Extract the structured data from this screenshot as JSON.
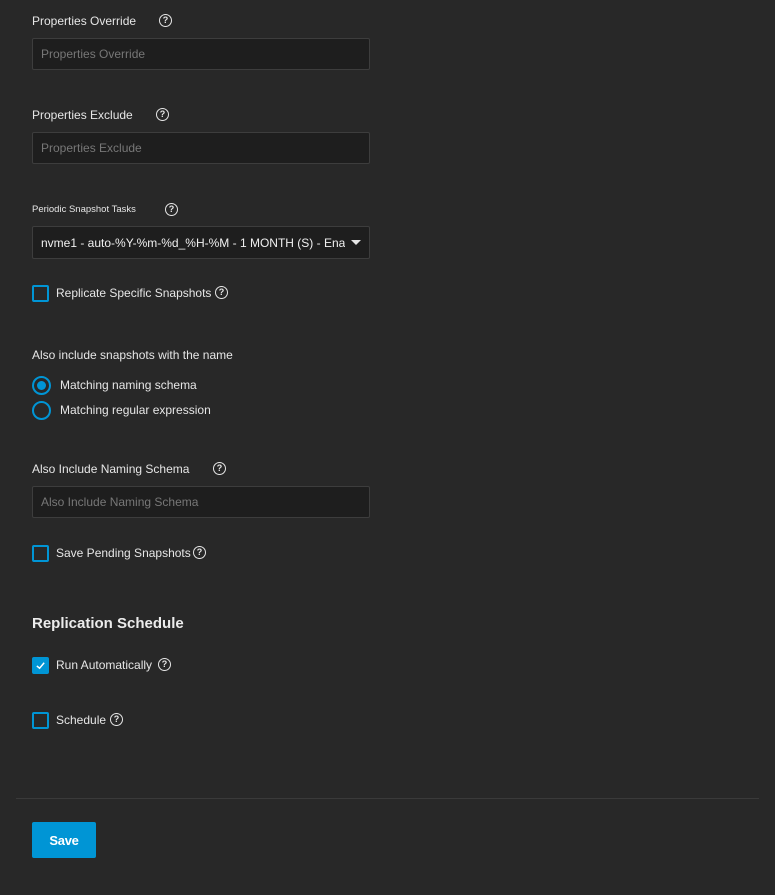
{
  "fields": {
    "properties_override": {
      "label": "Properties Override",
      "placeholder": "Properties Override"
    },
    "properties_exclude": {
      "label": "Properties Exclude",
      "placeholder": "Properties Exclude"
    },
    "periodic_snapshot_tasks": {
      "label": "Periodic Snapshot Tasks",
      "value": "nvme1 - auto-%Y-%m-%d_%H-%M - 1 MONTH (S) - Ena..."
    },
    "replicate_specific_snapshots": {
      "label": "Replicate Specific Snapshots",
      "checked": false
    },
    "also_include_group": {
      "label": "Also include snapshots with the name",
      "options": [
        {
          "label": "Matching naming schema",
          "selected": true
        },
        {
          "label": "Matching regular expression",
          "selected": false
        }
      ]
    },
    "also_include_naming_schema": {
      "label": "Also Include Naming Schema",
      "placeholder": "Also Include Naming Schema"
    },
    "save_pending_snapshots": {
      "label": "Save Pending Snapshots",
      "checked": false
    }
  },
  "replication_schedule": {
    "title": "Replication Schedule",
    "run_automatically": {
      "label": "Run Automatically",
      "checked": true
    },
    "schedule": {
      "label": "Schedule",
      "checked": false
    }
  },
  "help_icon_glyph": "?",
  "actions": {
    "save_label": "Save"
  },
  "colors": {
    "background": "#282828",
    "accent": "#0095d5",
    "input_background": "#1e1e1e"
  }
}
